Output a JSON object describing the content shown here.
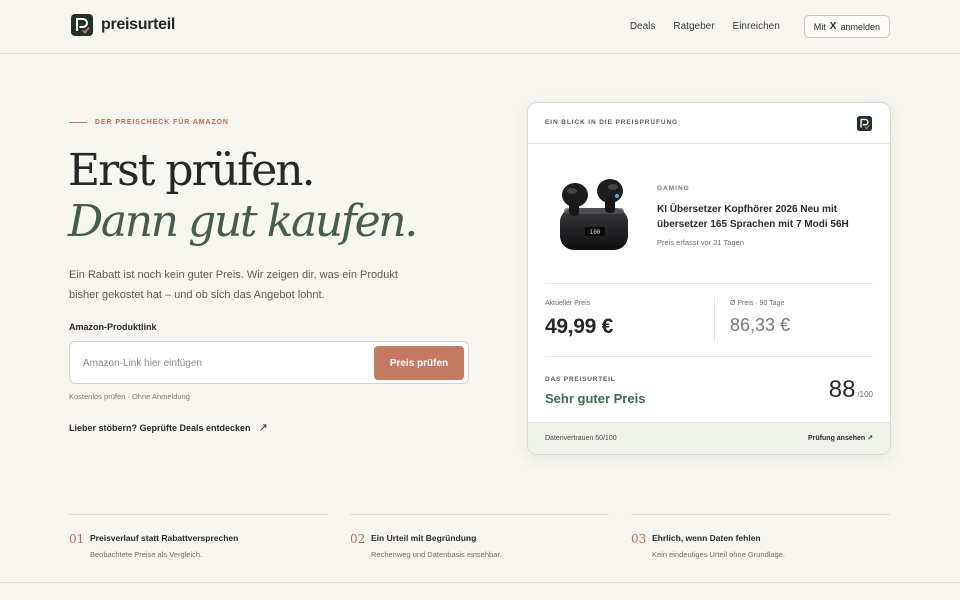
{
  "brand": {
    "name": "preisurteil"
  },
  "nav": {
    "links": [
      "Deals",
      "Ratgeber",
      "Einreichen"
    ],
    "login": {
      "prefix": "Mit",
      "x_icon": "X",
      "action": "anmelden"
    }
  },
  "hero": {
    "eyebrow": "DER PREISCHECK FÜR AMAZON",
    "title_line1": "Erst prüfen.",
    "title_line2": "Dann gut kaufen.",
    "lead": "Ein Rabatt ist noch kein guter Preis. Wir zeigen dir, was ein Produkt bisher gekostet hat – und ob sich das Angebot lohnt.",
    "field_label": "Amazon-Produktlink",
    "input_placeholder": "Amazon-Link hier einfügen",
    "input_value": "",
    "button": "Preis prüfen",
    "hint": "Kostenlos prüfen · Ohne Anmeldung",
    "browse_link": "Lieber stöbern? Geprüfte Deals entdecken"
  },
  "card": {
    "header": "EIN BLICK IN DIE PREISPRÜFUNG",
    "product": {
      "category": "GAMING",
      "name": "KI Übersetzer Kopfhörer 2026 Neu mit übersetzer 165 Sprachen mit 7 Modi 56H",
      "meta": "Preis erfasst vor 21 Tagen",
      "image_icon": "earbuds-case",
      "screen_text": "100"
    },
    "current_price": {
      "label": "Aktueller Preis",
      "value": "49,99 €"
    },
    "avg_price": {
      "label": "Ø Preis · 90 Tage",
      "value": "86,33 €"
    },
    "verdict": {
      "label": "DAS PREISURTEIL",
      "value": "Sehr guter Preis",
      "score": "88",
      "score_max": "/100"
    },
    "footer": {
      "left": "Datenvertrauen 50/100",
      "right": "Prüfung ansehen ↗"
    }
  },
  "features": [
    {
      "num": "01",
      "title": "Preisverlauf statt Rabattversprechen",
      "text": "Beobachtete Preise als Vergleich."
    },
    {
      "num": "02",
      "title": "Ein Urteil mit Begründung",
      "text": "Rechenweg und Datenbasis einsehbar."
    },
    {
      "num": "03",
      "title": "Ehrlich, wenn Daten fehlen",
      "text": "Kein eindeutiges Urteil ohne Grundlage."
    }
  ],
  "colors": {
    "accent": "#c67a63",
    "green": "#3f6b50",
    "background": "#f8f6f1",
    "dark": "#242927"
  }
}
